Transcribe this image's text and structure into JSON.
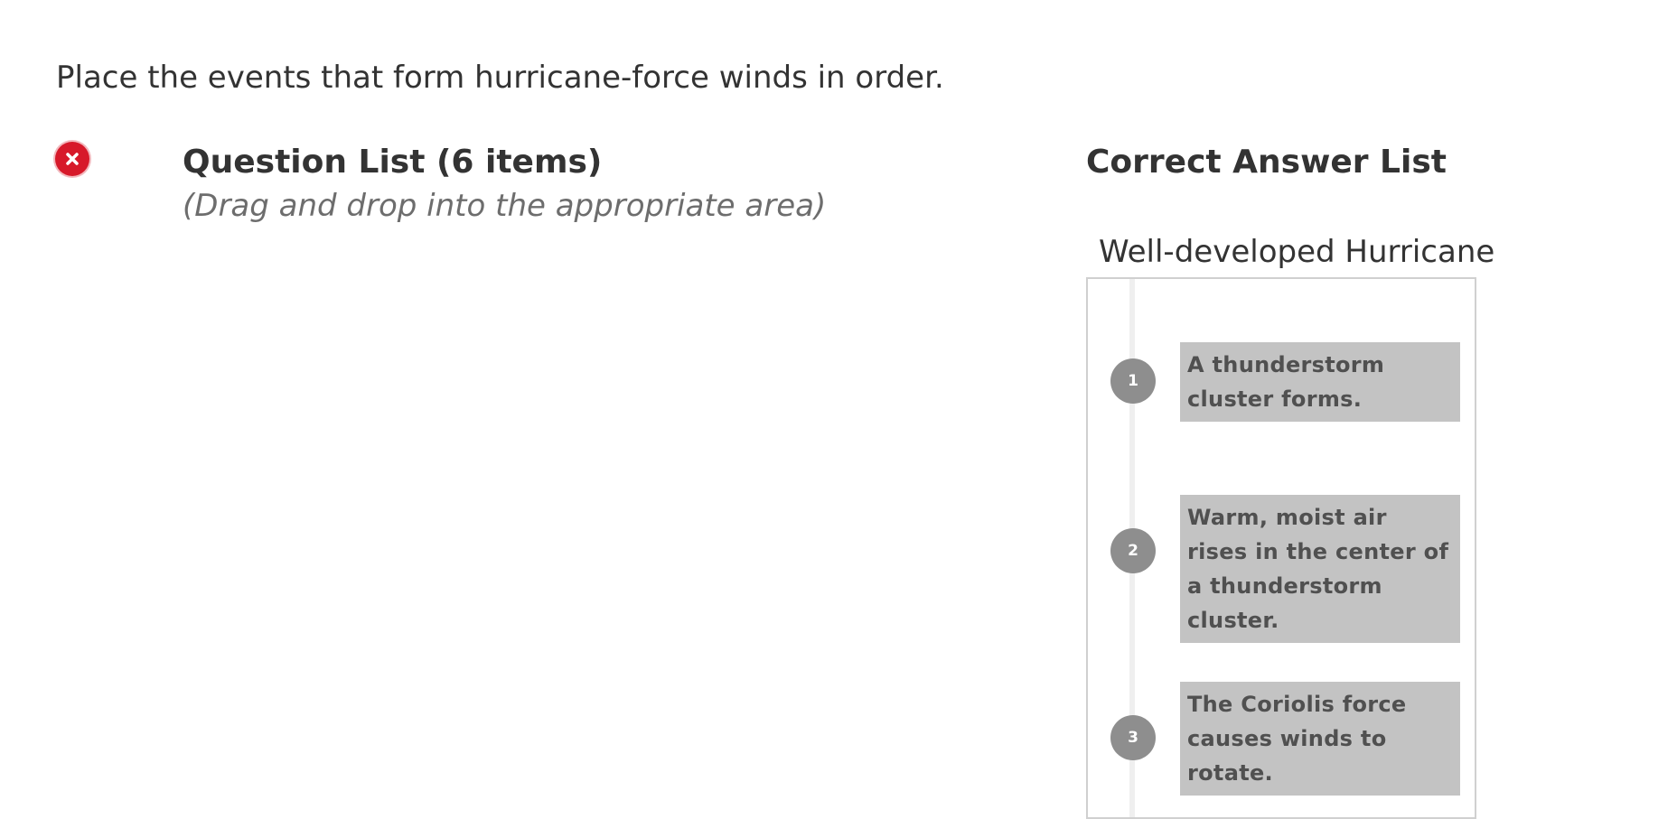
{
  "prompt": "Place the events that form hurricane-force winds in order.",
  "status": {
    "icon": "error-x-icon",
    "color": "#d7192a"
  },
  "question_list": {
    "title": "Question List (6 items)",
    "instruction": "(Drag and drop into the appropriate area)"
  },
  "answer_list": {
    "title": "Correct Answer List",
    "group_title": "Well-developed Hurricane",
    "items": [
      {
        "number": "1",
        "text": "A thunderstorm cluster forms."
      },
      {
        "number": "2",
        "text": "Warm, moist air rises in the center of a thunderstorm cluster."
      },
      {
        "number": "3",
        "text": "The Coriolis force causes winds to rotate."
      }
    ]
  }
}
